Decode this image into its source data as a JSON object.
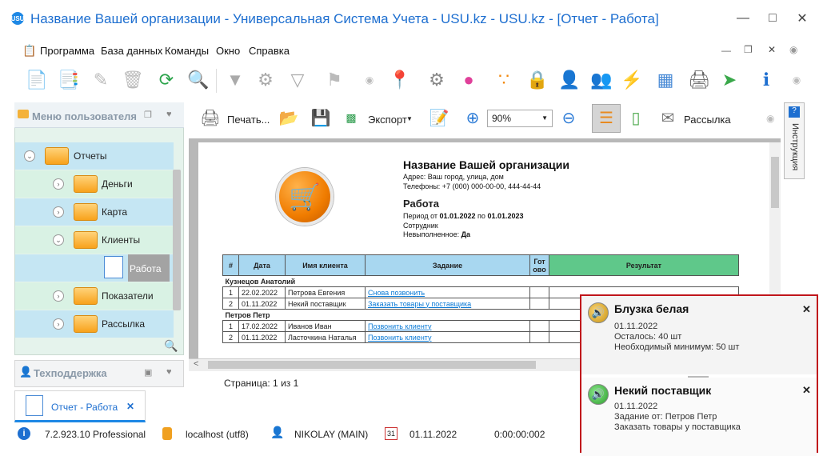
{
  "window": {
    "title": "Название Вашей организации - Универсальная Система Учета - USU.kz - USU.kz - [Отчет - Работа]",
    "app_icon": "USU"
  },
  "menu": [
    "Программа",
    "База данных",
    "Команды",
    "Окно",
    "Справка"
  ],
  "left_panel": {
    "title": "Меню пользователя",
    "tree": [
      {
        "label": "Отчеты"
      },
      {
        "label": "Деньги"
      },
      {
        "label": "Карта"
      },
      {
        "label": "Клиенты"
      },
      {
        "label": "Работа"
      },
      {
        "label": "Показатели"
      },
      {
        "label": "Рассылка"
      }
    ]
  },
  "support_panel": {
    "title": "Техподдержка"
  },
  "report_toolbar": {
    "print": "Печать...",
    "export": "Экспорт",
    "zoom": "90%",
    "mailing": "Рассылка"
  },
  "right_tab": "Инструкция",
  "report": {
    "org_name": "Название Вашей организации",
    "address": "Адрес: Ваш город, улица, дом",
    "phones": "Телефоны: +7 (000) 000-00-00, 444-44-44",
    "title": "Работа",
    "period_prefix": "Период от ",
    "period_from": "01.01.2022",
    "period_mid": " по ",
    "period_to": "01.01.2023",
    "employee": "Сотрудник",
    "undone_prefix": "Невыполненное: ",
    "undone_value": "Да",
    "columns": [
      "#",
      "Дата",
      "Имя клиента",
      "Задание",
      "Гот ово",
      "Результат"
    ],
    "groups": [
      {
        "name": "Кузнецов Анатолий",
        "rows": [
          {
            "n": "1",
            "date": "22.02.2022",
            "client": "Петрова Евгения",
            "task": "Снова позвонить"
          },
          {
            "n": "2",
            "date": "01.11.2022",
            "client": "Некий поставщик",
            "task": "Заказать товары у поставщика"
          }
        ]
      },
      {
        "name": "Петров Петр",
        "rows": [
          {
            "n": "1",
            "date": "17.02.2022",
            "client": "Иванов Иван",
            "task": "Позвонить клиенту"
          },
          {
            "n": "2",
            "date": "01.11.2022",
            "client": "Ласточкина Наталья",
            "task": "Позвонить клиенту"
          }
        ]
      }
    ]
  },
  "page_info": "Страница: 1 из 1",
  "doc_tab": {
    "label": "Отчет - Работа",
    "close": "✕"
  },
  "status": {
    "version": "7.2.923.10 Professional",
    "db": "localhost (utf8)",
    "user": "NIKOLAY (MAIN)",
    "date": "01.11.2022",
    "timer": "0:00:00:002",
    "calendar_day": "31"
  },
  "notifications": [
    {
      "title": "Блузка белая",
      "lines": [
        "01.11.2022",
        "Осталось: 40 шт",
        "Необходимый минимум: 50 шт"
      ]
    },
    {
      "title": "Некий поставщик",
      "lines": [
        "01.11.2022",
        "Задание от: Петров Петр",
        "Заказать товары у поставщика"
      ]
    }
  ]
}
